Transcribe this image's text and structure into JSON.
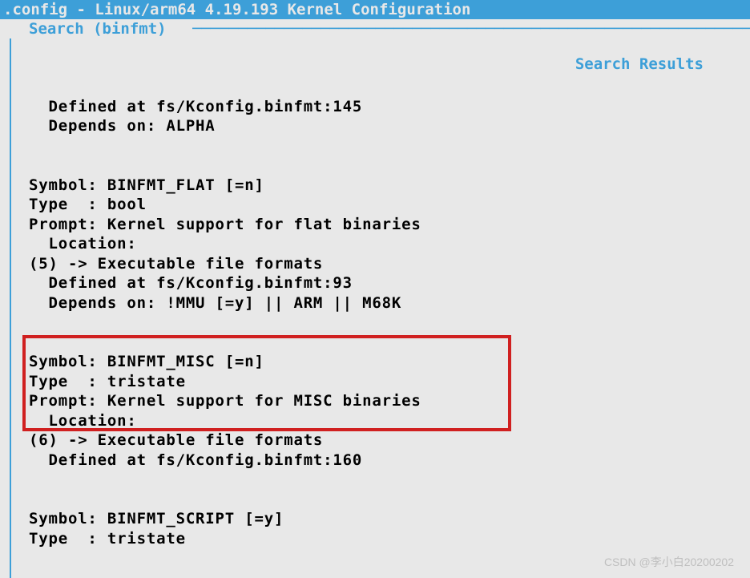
{
  "title": ".config - Linux/arm64 4.19.193 Kernel Configuration",
  "search_label": "Search (binfmt)",
  "results_label": "Search Results",
  "content": {
    "line1": "  Defined at fs/Kconfig.binfmt:145",
    "line2": "  Depends on: ALPHA",
    "blank1": "",
    "blank2": "",
    "flat_symbol": "Symbol: BINFMT_FLAT [=n]",
    "flat_type": "Type  : bool",
    "flat_prompt": "Prompt: Kernel support for flat binaries",
    "flat_location": "  Location:",
    "flat_menu": "(5) -> Executable file formats",
    "flat_defined": "  Defined at fs/Kconfig.binfmt:93",
    "flat_depends": "  Depends on: !MMU [=y] || ARM || M68K",
    "blank3": "",
    "blank4": "",
    "misc_symbol": "Symbol: BINFMT_MISC [=n]",
    "misc_type": "Type  : tristate",
    "misc_prompt": "Prompt: Kernel support for MISC binaries",
    "misc_location": "  Location:",
    "misc_menu": "(6) -> Executable file formats",
    "misc_defined": "  Defined at fs/Kconfig.binfmt:160",
    "blank5": "",
    "blank6": "",
    "script_symbol": "Symbol: BINFMT_SCRIPT [=y]",
    "script_type": "Type  : tristate"
  },
  "watermark": "CSDN @李小白20200202"
}
